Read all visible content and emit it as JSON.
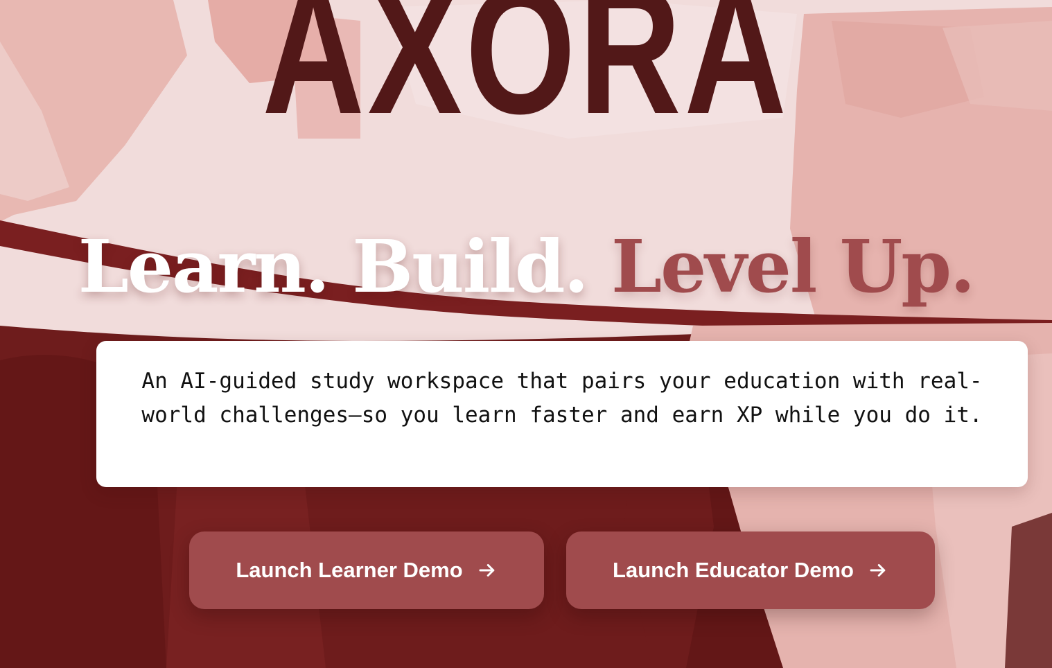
{
  "brand": {
    "name": "AXORA"
  },
  "hero": {
    "tagline_part1": "Learn. Build.",
    "tagline_part2": "Level Up.",
    "description": "An AI-guided study workspace that pairs your education with real-world challenges—so you learn faster and earn XP while you do it."
  },
  "actions": {
    "learner_label": "Launch Learner Demo",
    "educator_label": "Launch Educator Demo",
    "arrow_icon": "arrow-right-icon"
  },
  "colors": {
    "brand_dark": "#521818",
    "accent": "#a04b4d",
    "background_light": "#f1dcdb",
    "background_deep": "#6e1c1c"
  }
}
